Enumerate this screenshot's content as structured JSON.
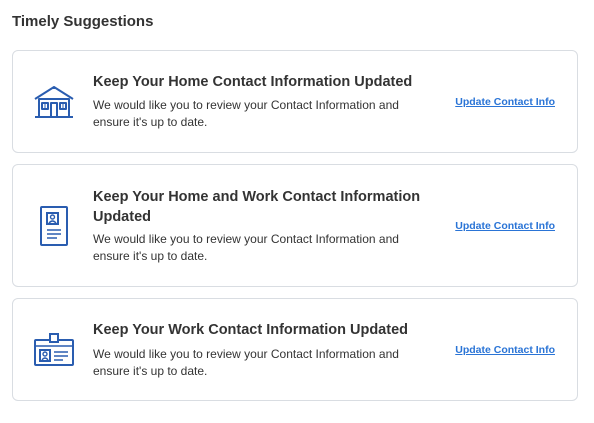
{
  "section": {
    "title": "Timely Suggestions"
  },
  "suggestions": [
    {
      "icon": "house-icon",
      "title": "Keep Your Home Contact Information Updated",
      "description": "We would like you to review your Contact Information and ensure it's up to date.",
      "action_label": "Update Contact Info"
    },
    {
      "icon": "document-profile-icon",
      "title": "Keep Your Home and Work Contact Information Updated",
      "description": "We would like you to review your Contact Information and ensure it's up to date.",
      "action_label": "Update Contact Info"
    },
    {
      "icon": "id-badge-icon",
      "title": "Keep Your Work Contact Information Updated",
      "description": "We would like you to review your Contact Information and ensure it's up to date.",
      "action_label": "Update Contact Info"
    }
  ],
  "colors": {
    "icon": "#2a5db0",
    "link": "#2a74d6",
    "border": "#d9dde2",
    "text": "#333333"
  }
}
